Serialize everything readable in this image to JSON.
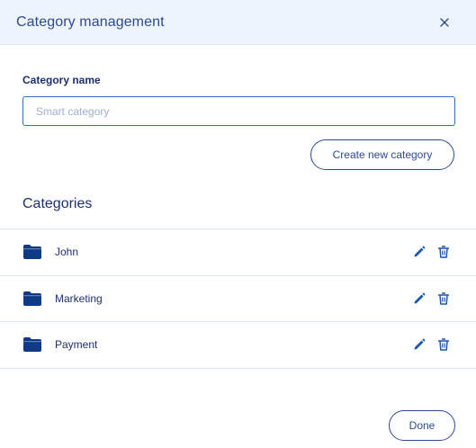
{
  "dialog": {
    "title": "Category management",
    "close_icon": "close-icon"
  },
  "form": {
    "label": "Category name",
    "placeholder": "Smart category",
    "value": "",
    "create_button": "Create new category"
  },
  "categories": {
    "title": "Categories",
    "items": [
      {
        "name": "John"
      },
      {
        "name": "Marketing"
      },
      {
        "name": "Payment"
      }
    ],
    "item_icon": "folder-icon",
    "edit_icon": "pencil-icon",
    "delete_icon": "trash-icon"
  },
  "footer": {
    "done_button": "Done"
  },
  "colors": {
    "primary": "#2c4a8f",
    "dark_text": "#1c2f6e",
    "header_bg": "#eef4fd",
    "icon_blue": "#1e55b3",
    "border": "#dbe6f5"
  }
}
